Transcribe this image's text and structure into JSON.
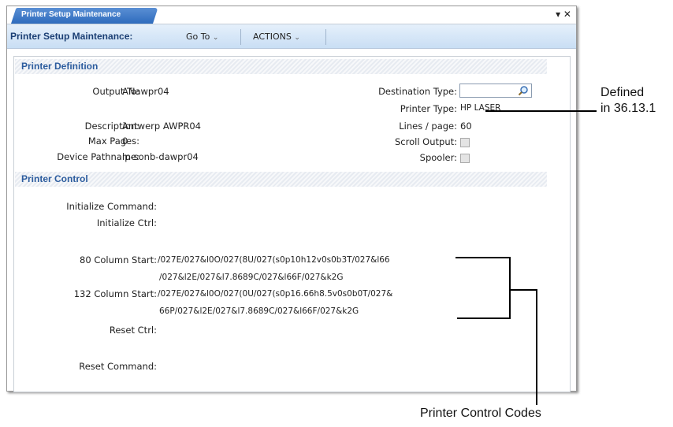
{
  "window": {
    "tab_title": "Printer Setup Maintenance",
    "controls": "▾ ✕"
  },
  "menubar": {
    "title": "Printer Setup Maintenance:",
    "goto": "Go To",
    "actions": "ACTIONS",
    "chevron": "⌄"
  },
  "printer_definition": {
    "heading": "Printer Definition",
    "output_to_label": "Output To:",
    "output_to_value": "ANawpr04",
    "description_label": "Description:",
    "description_value": "Antwerp AWPR04",
    "max_pages_label": "Max Pages:",
    "max_pages_value": "0",
    "device_pathname_label": "Device Pathname:",
    "device_pathname_value": "lp-sonb-dawpr04",
    "destination_type_label": "Destination Type:",
    "destination_type_value": "",
    "printer_type_label": "Printer Type:",
    "printer_type_value": "HP LASER",
    "lines_page_label": "Lines / page:",
    "lines_page_value": "60",
    "scroll_output_label": "Scroll Output:",
    "spooler_label": "Spooler:"
  },
  "printer_control": {
    "heading": "Printer Control",
    "init_command_label": "Initialize Command:",
    "init_ctrl_label": "Initialize Ctrl:",
    "col80_label": "80 Column Start:",
    "col80_line1": "/027E/027&l0O/027(8U/027(s0p10h12v0s0b3T/027&l66",
    "col80_line2": "/027&l2E/027&l7.8689C/027&l66F/027&k2G",
    "col132_label": "132 Column Start:",
    "col132_line1": "/027E/027&l0O/027(0U/027(s0p16.66h8.5v0s0b0T/027&",
    "col132_line2": "66P/027&l2E/027&l7.8689C/027&l66F/027&k2G",
    "reset_ctrl_label": "Reset Ctrl:",
    "reset_command_label": "Reset Command:"
  },
  "annotations": {
    "defined_line1": "Defined",
    "defined_line2": "in 36.13.1",
    "control_codes": "Printer Control Codes"
  }
}
